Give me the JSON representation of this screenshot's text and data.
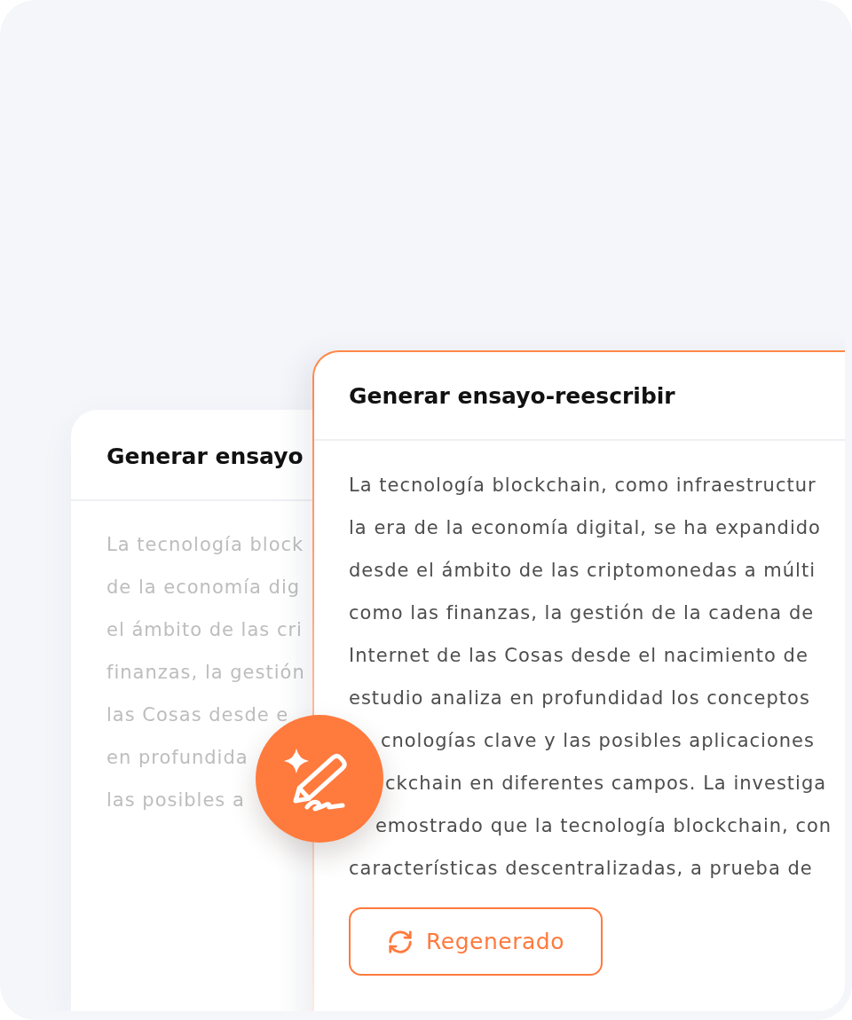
{
  "back_card": {
    "title": "Generar ensayo",
    "lines": [
      "La tecnología block",
      "de la economía dig",
      "el ámbito de las cri",
      "finanzas, la gestión",
      "las Cosas desde e",
      "en profundida",
      "las posibles a"
    ]
  },
  "front_card": {
    "title": "Generar ensayo-reescribir",
    "lines": [
      "La tecnología blockchain, como infraestructur",
      "la era de la economía digital, se ha expandido",
      "desde el ámbito de las criptomonedas a múlti",
      "como las finanzas, la gestión de la cadena de",
      "Internet de las Cosas desde el nacimiento de",
      "estudio analiza en profundidad los conceptos",
      "cnologías clave y las posibles aplicaciones",
      "ckchain en diferentes campos. La investiga",
      "emostrado que la tecnología blockchain, con",
      "características descentralizadas, a prueba de"
    ],
    "button": {
      "label": "Regenerado"
    }
  }
}
